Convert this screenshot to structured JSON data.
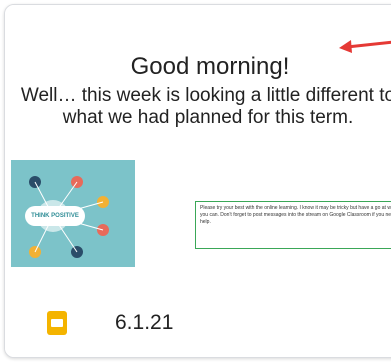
{
  "card": {
    "slide": {
      "title": "Good morning!",
      "body": "Well… this week is looking a little different to what we had planned for this term.",
      "poster_label": "THINK POSITIVE",
      "note": "Please try your best with the online learning. I know it may be tricky but have a go at what you can. Don't forget to post messages into the stream on Google Classroom if you need help."
    },
    "date": "6.1.21"
  },
  "colors": {
    "arrow": "#e53935",
    "note_border": "#3aa757",
    "poster_bg": "#7cc3c9",
    "slides_icon": "#f4b400"
  },
  "icons": {
    "file_type": "google-slides-icon",
    "annotation": "red-arrow-icon"
  }
}
